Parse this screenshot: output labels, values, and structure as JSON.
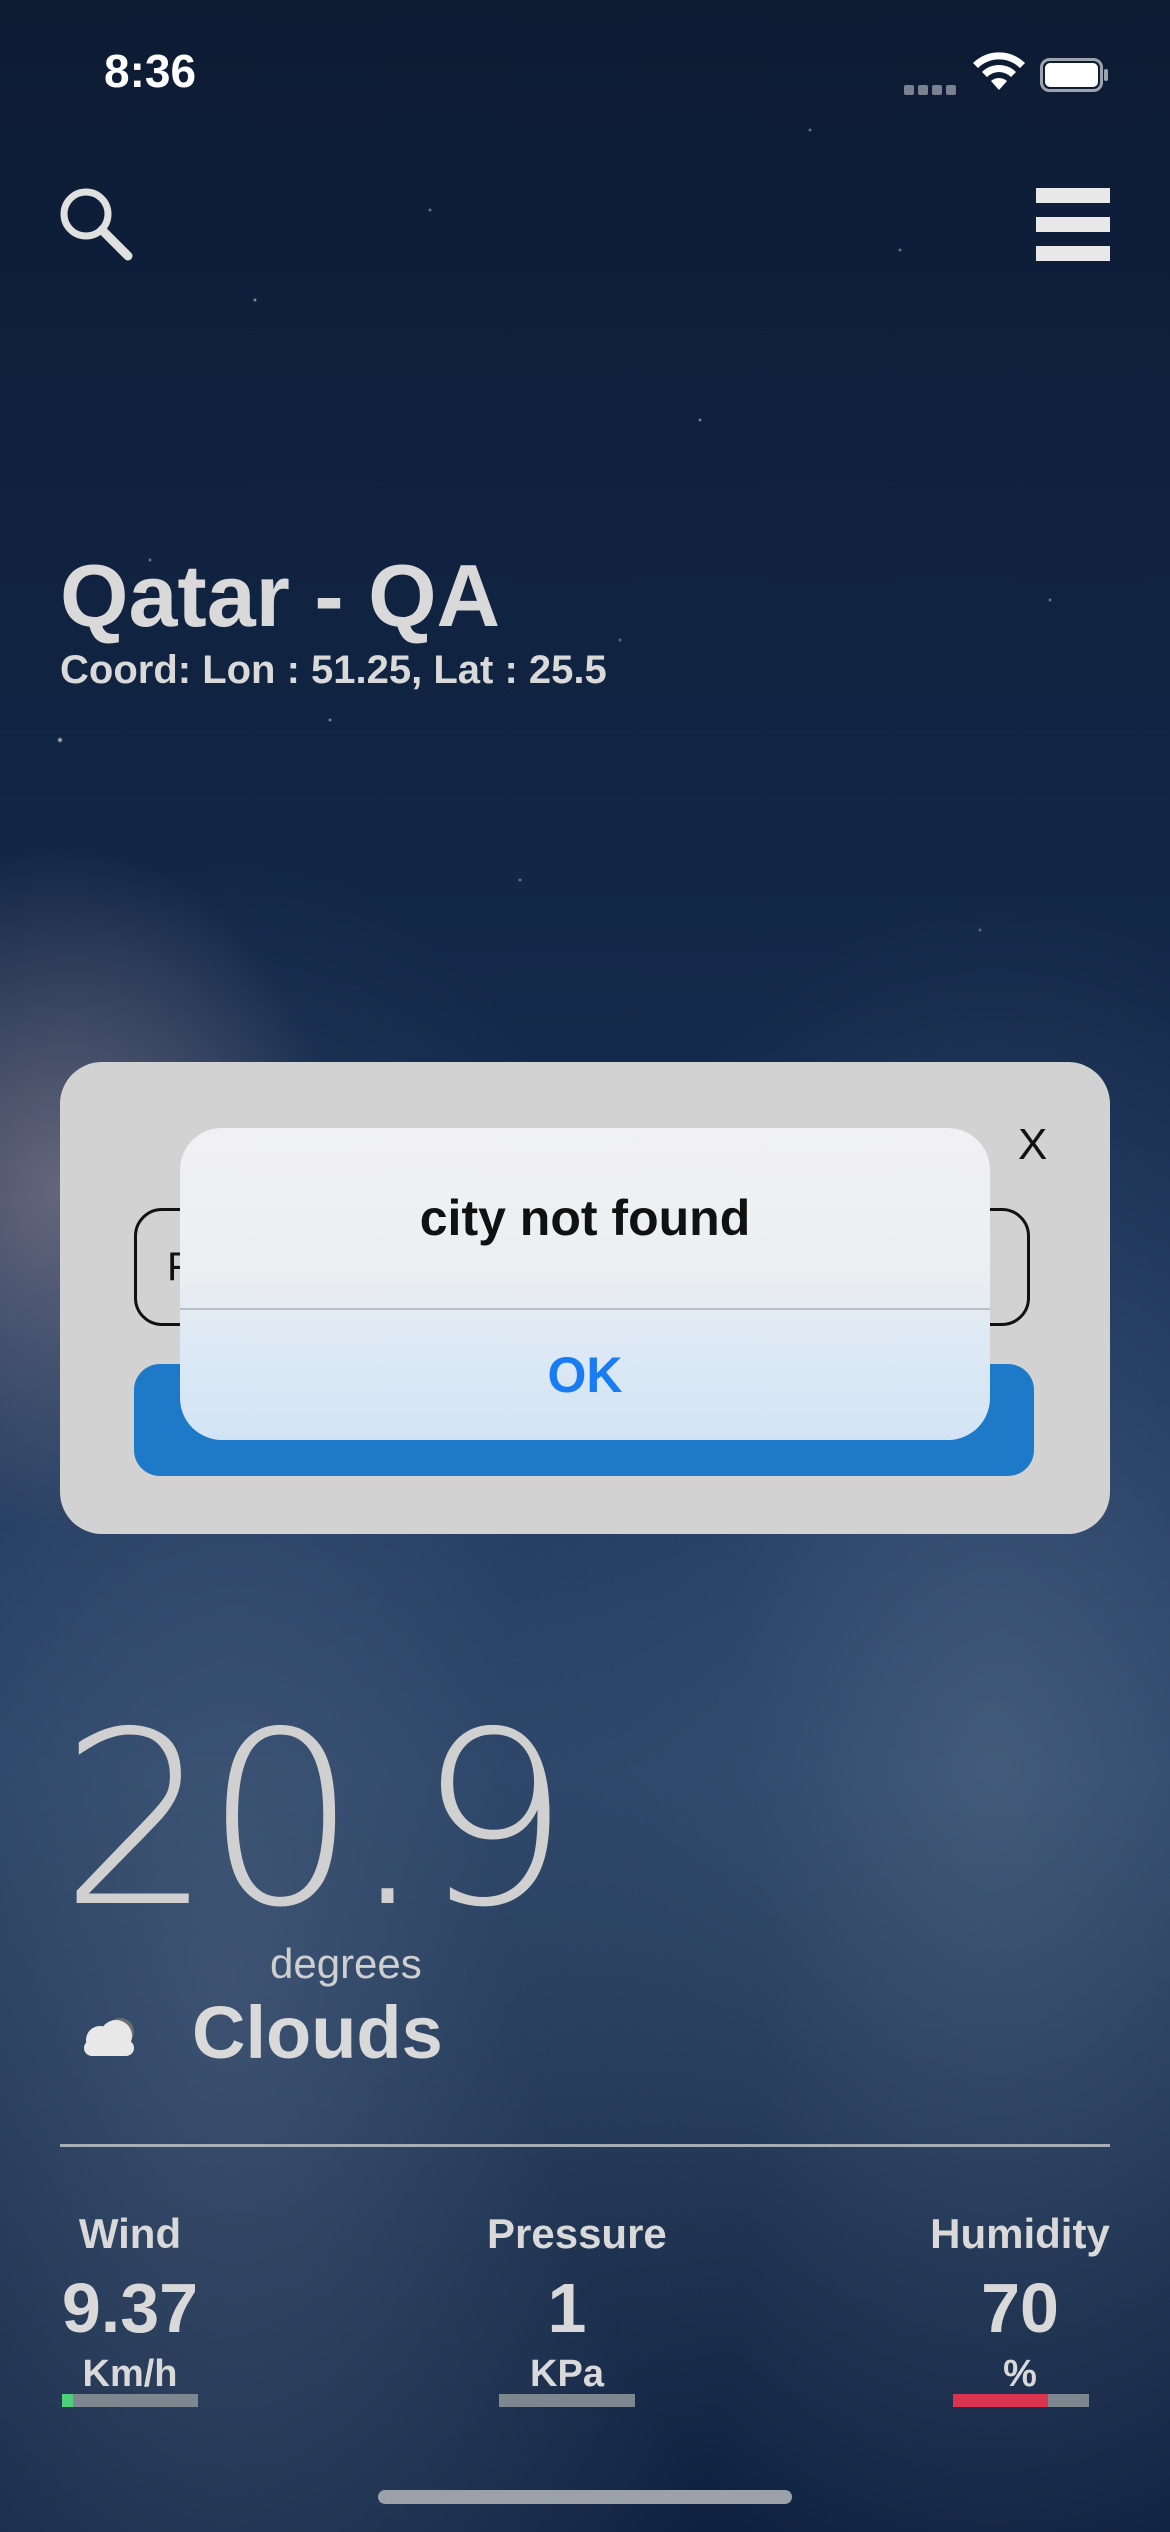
{
  "status_bar": {
    "time": "8:36",
    "signal_icon": "cellular-dots-icon",
    "wifi_icon": "wifi-icon",
    "battery_icon": "battery-full-icon"
  },
  "toolbar": {
    "search_icon": "search-icon",
    "menu_icon": "hamburger-menu-icon"
  },
  "location": {
    "title": "Qatar - QA",
    "coords": "Coord: Lon : 51.25, Lat : 25.5"
  },
  "search_modal": {
    "close_label": "X",
    "input_value": "F",
    "submit_color": "#1e79c9"
  },
  "alert": {
    "title": "city not found",
    "ok_label": "OK",
    "ok_color": "#1a7cf2"
  },
  "weather": {
    "temperature": "20.9",
    "unit": "degrees",
    "condition": "Clouds",
    "condition_icon": "cloud-icon"
  },
  "stats": {
    "wind": {
      "label": "Wind",
      "value": "9.37",
      "unit": "Km/h",
      "level": 0.08,
      "color": "#4cd07a"
    },
    "pressure": {
      "label": "Pressure",
      "value": "1",
      "unit": "KPa",
      "level": 0.0,
      "color": "#7c8790"
    },
    "humidity": {
      "label": "Humidity",
      "value": "70",
      "unit": "%",
      "level": 0.7,
      "color": "#d9334f"
    }
  }
}
